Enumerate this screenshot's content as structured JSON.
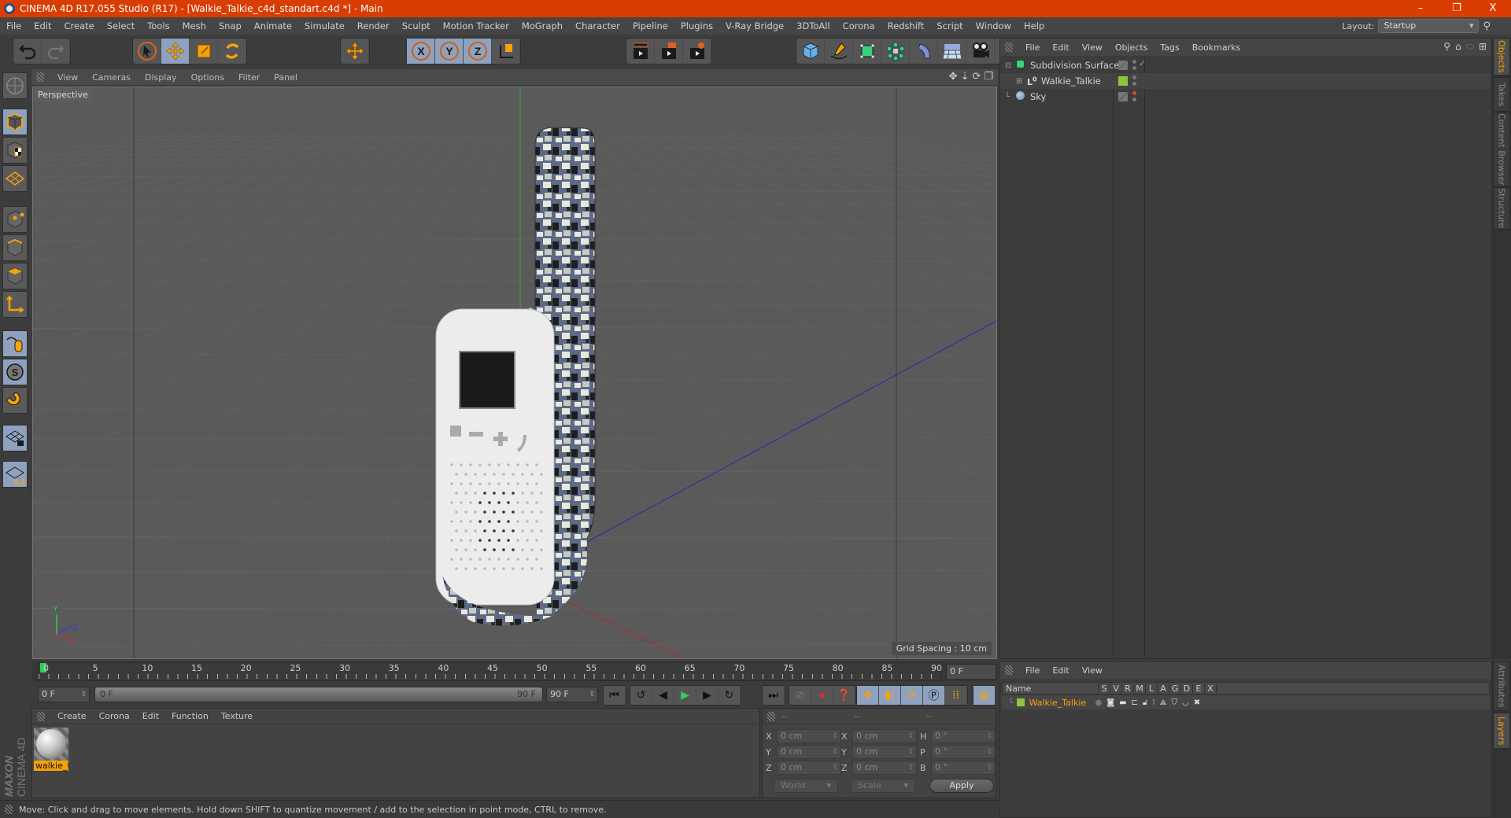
{
  "window": {
    "title": "CINEMA 4D R17.055 Studio (R17) - [Walkie_Talkie_c4d_standart.c4d *] - Main",
    "minimize": "–",
    "restore": "❐",
    "close": "X"
  },
  "menubar": {
    "items": [
      "File",
      "Edit",
      "Create",
      "Select",
      "Tools",
      "Mesh",
      "Snap",
      "Animate",
      "Simulate",
      "Render",
      "Sculpt",
      "Motion Tracker",
      "MoGraph",
      "Character",
      "Pipeline",
      "Plugins",
      "V-Ray Bridge",
      "3DToAll",
      "Corona",
      "Redshift",
      "Script",
      "Window",
      "Help"
    ],
    "layout_label": "Layout:",
    "layout_value": "Startup"
  },
  "toolbar": {
    "groups": [
      [
        "undo-icon",
        "redo-icon"
      ],
      [
        "live-selection-icon",
        "move-icon",
        "scale-icon",
        "rotate-icon"
      ],
      [
        "recent-tool-icon"
      ],
      [
        "x-axis-icon",
        "y-axis-icon",
        "z-axis-icon",
        "coordinate-system-icon"
      ],
      [
        "render-view-icon",
        "render-active-icon",
        "render-settings-icon"
      ],
      [
        "cube-icon",
        "pen-spline-icon",
        "subdivision-surface-icon",
        "cloner-icon",
        "deformer-icon",
        "floor-icon",
        "camera-icon",
        "light-icon"
      ]
    ],
    "active": [
      "move-icon",
      "x-axis-icon",
      "y-axis-icon",
      "z-axis-icon"
    ]
  },
  "left_toolbar": {
    "items": [
      "make-editable-icon",
      "model-mode-icon",
      "texture-mode-icon",
      "workplane-icon",
      "points-mode-icon",
      "edges-mode-icon",
      "polygons-mode-icon",
      "axis-mode-icon",
      "tweak-mode-icon",
      "solo-icon",
      "snap-magnet-icon",
      "locked-workplane-icon",
      "planar-workplane-icon"
    ],
    "active": [
      "model-mode-icon",
      "tweak-mode-icon",
      "solo-icon",
      "locked-workplane-icon",
      "planar-workplane-icon"
    ]
  },
  "viewport": {
    "menu": [
      "View",
      "Cameras",
      "Display",
      "Options",
      "Filter",
      "Panel"
    ],
    "label": "Perspective",
    "grid_spacing": "Grid Spacing : 10 cm",
    "axes": {
      "x": "X",
      "y": "Y",
      "z": "Z"
    },
    "colors": {
      "x_axis": "#c03030",
      "y_axis": "#30c030",
      "z_axis": "#3030c0",
      "background": "#5a5a5a"
    }
  },
  "timeline": {
    "ticks": [
      "0",
      "5",
      "10",
      "15",
      "20",
      "25",
      "30",
      "35",
      "40",
      "45",
      "50",
      "55",
      "60",
      "65",
      "70",
      "75",
      "80",
      "85",
      "90"
    ],
    "current_frame": "0 F",
    "start_frame": "0 F",
    "range_start": "0 F",
    "range_end": "90 F",
    "end_frame": "90 F",
    "playhead_fraction": 0.0
  },
  "transport": {
    "buttons": [
      "go-to-start-icon",
      "previous-key-icon",
      "previous-frame-icon",
      "play-icon",
      "next-frame-icon",
      "next-key-icon",
      "go-to-end-icon",
      "record-disabled-icon",
      "autokey-icon",
      "keyframe-selection-icon",
      "key-position-icon",
      "key-scale-icon",
      "key-rotation-icon",
      "key-parameter-icon",
      "key-pla-icon",
      "timeline-icon"
    ]
  },
  "materials": {
    "menu": [
      "Create",
      "Corona",
      "Edit",
      "Function",
      "Texture"
    ],
    "items": [
      {
        "name": "walkie_t"
      }
    ]
  },
  "coordinates": {
    "headers": [
      "--",
      "--",
      "--"
    ],
    "rows": [
      {
        "l1": "X",
        "v1": "0 cm",
        "l2": "X",
        "v2": "0 cm",
        "l3": "H",
        "v3": "0 °"
      },
      {
        "l1": "Y",
        "v1": "0 cm",
        "l2": "Y",
        "v2": "0 cm",
        "l3": "P",
        "v3": "0 °"
      },
      {
        "l1": "Z",
        "v1": "0 cm",
        "l2": "Z",
        "v2": "0 cm",
        "l3": "B",
        "v3": "0 °"
      }
    ],
    "mode": "World",
    "transform": "Scale",
    "apply": "Apply"
  },
  "status": {
    "text": "Move: Click and drag to move elements. Hold down SHIFT to quantize movement / add to the selection in point mode, CTRL to remove."
  },
  "object_manager": {
    "menu": [
      "File",
      "Edit",
      "View",
      "Objects",
      "Tags",
      "Bookmarks"
    ],
    "objects": [
      {
        "name": "Subdivision Surface",
        "icon": "subdivision-surface-icon",
        "layer_color": "",
        "dot": "grey",
        "check": "✓"
      },
      {
        "name": "Walkie_Talkie",
        "icon": "null-object-icon",
        "layer_color": "#8cc63f",
        "dot": "grey",
        "check": ""
      },
      {
        "name": "Sky",
        "icon": "sky-icon",
        "layer_color": "",
        "dot": "red",
        "check": ""
      }
    ]
  },
  "side_tabs_top": [
    {
      "label": "Objects",
      "active": true
    },
    {
      "label": "Takes",
      "active": false
    },
    {
      "label": "Content Browser",
      "active": false
    },
    {
      "label": "Structure",
      "active": false
    }
  ],
  "layer_manager": {
    "menu": [
      "File",
      "Edit",
      "View"
    ],
    "columns": [
      "Name",
      "S",
      "V",
      "R",
      "M",
      "L",
      "A",
      "G",
      "D",
      "E",
      "X"
    ],
    "layers": [
      {
        "name": "Walkie_Talkie",
        "color": "#8cc63f"
      }
    ]
  },
  "side_tabs_bottom": [
    {
      "label": "Attributes",
      "active": false
    },
    {
      "label": "Layers",
      "active": true
    }
  ],
  "maxon_logo": {
    "brand": "MAXON",
    "product": "CINEMA 4D"
  },
  "accent_color": "#f5a20a"
}
